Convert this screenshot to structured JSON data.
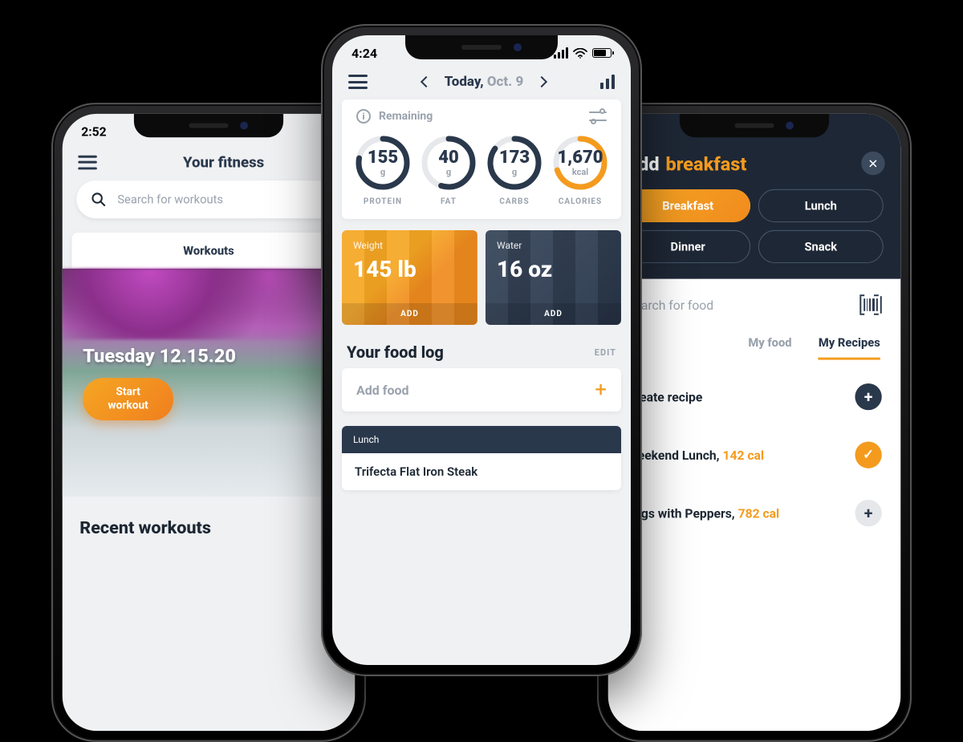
{
  "left": {
    "status_time": "2:52",
    "title": "Your fitness",
    "search_placeholder": "Search for workouts",
    "tab_workouts": "Workouts",
    "hero_date": "Tuesday 12.15.20",
    "start_btn_l1": "Start",
    "start_btn_l2": "workout",
    "recent_h": "Recent workouts"
  },
  "center": {
    "status_time": "4:24",
    "date_label": "Today,",
    "date_value": "Oct. 9",
    "remaining_label": "Remaining",
    "rings": [
      {
        "value": "155",
        "unit": "g",
        "label": "PROTEIN",
        "pct": 78,
        "color": "#2a384c"
      },
      {
        "value": "40",
        "unit": "g",
        "label": "FAT",
        "pct": 55,
        "color": "#2a384c"
      },
      {
        "value": "173",
        "unit": "g",
        "label": "CARBS",
        "pct": 85,
        "color": "#2a384c"
      },
      {
        "value": "1,670",
        "unit": "kcal",
        "label": "CALORIES",
        "pct": 70,
        "color": "#f49b1e"
      }
    ],
    "weight_label": "Weight",
    "weight_value": "145 lb",
    "water_label": "Water",
    "water_value": "16 oz",
    "add_label": "ADD",
    "foodlog_h": "Your food log",
    "edit_label": "EDIT",
    "addfood_label": "Add food",
    "meal_name": "Lunch",
    "meal_item": "Trifecta Flat Iron Steak"
  },
  "right": {
    "title_prefix": "Add",
    "title_accent": "breakfast",
    "pills": [
      "Breakfast",
      "Lunch",
      "Dinner",
      "Snack"
    ],
    "pill_active": 0,
    "search_text": "Search for food",
    "tabs": [
      "My food",
      "My Recipes"
    ],
    "tab_active": 1,
    "items": [
      {
        "text": "Create recipe",
        "suffix": "",
        "icon": "dark-plus"
      },
      {
        "text": "Weekend Lunch,",
        "suffix": "142 cal",
        "icon": "orange-check"
      },
      {
        "text": "Eggs with Peppers,",
        "suffix": "782 cal",
        "icon": "grey-plus"
      }
    ]
  }
}
